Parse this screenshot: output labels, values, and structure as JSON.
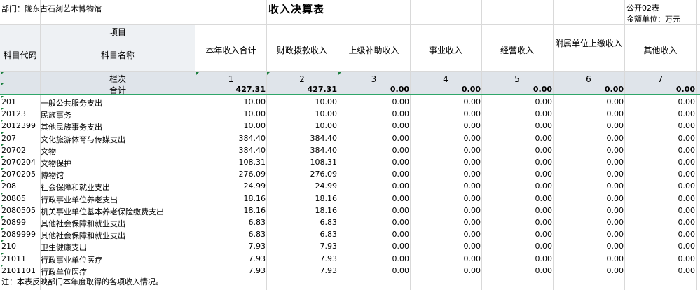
{
  "header": {
    "department": "部门：陇东古石刻艺术博物馆",
    "title": "收入决算表",
    "form_code": "公开02表",
    "unit": "金额单位：万元"
  },
  "columns": {
    "item_group": "项目",
    "code": "科目代码",
    "name": "科目名称",
    "c1": "本年收入合计",
    "c2": "财政拨款收入",
    "c3": "上级补助收入",
    "c4": "事业收入",
    "c5": "经营收入",
    "c6": "附属单位上缴收入",
    "c7": "其他收入"
  },
  "index_row": {
    "label": "栏次",
    "n1": "1",
    "n2": "2",
    "n3": "3",
    "n4": "4",
    "n5": "5",
    "n6": "6",
    "n7": "7"
  },
  "total_row": {
    "label": "合计",
    "v1": "427.31",
    "v2": "427.31",
    "v3": "0.00",
    "v4": "0.00",
    "v5": "0.00",
    "v6": "0.00",
    "v7": "0.00"
  },
  "rows": [
    {
      "code": "201",
      "name": "一般公共服务支出",
      "v1": "10.00",
      "v2": "10.00",
      "v3": "0.00",
      "v4": "0.00",
      "v5": "0.00",
      "v6": "0.00",
      "v7": "0.00"
    },
    {
      "code": "20123",
      "name": "民族事务",
      "v1": "10.00",
      "v2": "10.00",
      "v3": "0.00",
      "v4": "0.00",
      "v5": "0.00",
      "v6": "0.00",
      "v7": "0.00"
    },
    {
      "code": "2012399",
      "name": "其他民族事务支出",
      "v1": "10.00",
      "v2": "10.00",
      "v3": "0.00",
      "v4": "0.00",
      "v5": "0.00",
      "v6": "0.00",
      "v7": "0.00"
    },
    {
      "code": "207",
      "name": "文化旅游体育与传媒支出",
      "v1": "384.40",
      "v2": "384.40",
      "v3": "0.00",
      "v4": "0.00",
      "v5": "0.00",
      "v6": "0.00",
      "v7": "0.00"
    },
    {
      "code": "20702",
      "name": "文物",
      "v1": "384.40",
      "v2": "384.40",
      "v3": "0.00",
      "v4": "0.00",
      "v5": "0.00",
      "v6": "0.00",
      "v7": "0.00"
    },
    {
      "code": "2070204",
      "name": "文物保护",
      "v1": "108.31",
      "v2": "108.31",
      "v3": "0.00",
      "v4": "0.00",
      "v5": "0.00",
      "v6": "0.00",
      "v7": "0.00"
    },
    {
      "code": "2070205",
      "name": "博物馆",
      "v1": "276.09",
      "v2": "276.09",
      "v3": "0.00",
      "v4": "0.00",
      "v5": "0.00",
      "v6": "0.00",
      "v7": "0.00"
    },
    {
      "code": "208",
      "name": "社会保障和就业支出",
      "v1": "24.99",
      "v2": "24.99",
      "v3": "0.00",
      "v4": "0.00",
      "v5": "0.00",
      "v6": "0.00",
      "v7": "0.00"
    },
    {
      "code": "20805",
      "name": "行政事业单位养老支出",
      "v1": "18.16",
      "v2": "18.16",
      "v3": "0.00",
      "v4": "0.00",
      "v5": "0.00",
      "v6": "0.00",
      "v7": "0.00"
    },
    {
      "code": "2080505",
      "name": "机关事业单位基本养老保险缴费支出",
      "v1": "18.16",
      "v2": "18.16",
      "v3": "0.00",
      "v4": "0.00",
      "v5": "0.00",
      "v6": "0.00",
      "v7": "0.00"
    },
    {
      "code": "20899",
      "name": "其他社会保障和就业支出",
      "v1": "6.83",
      "v2": "6.83",
      "v3": "0.00",
      "v4": "0.00",
      "v5": "0.00",
      "v6": "0.00",
      "v7": "0.00"
    },
    {
      "code": "2089999",
      "name": "其他社会保障和就业支出",
      "v1": "6.83",
      "v2": "6.83",
      "v3": "0.00",
      "v4": "0.00",
      "v5": "0.00",
      "v6": "0.00",
      "v7": "0.00"
    },
    {
      "code": "210",
      "name": "卫生健康支出",
      "v1": "7.93",
      "v2": "7.93",
      "v3": "0.00",
      "v4": "0.00",
      "v5": "0.00",
      "v6": "0.00",
      "v7": "0.00"
    },
    {
      "code": "21011",
      "name": "行政事业单位医疗",
      "v1": "7.93",
      "v2": "7.93",
      "v3": "0.00",
      "v4": "0.00",
      "v5": "0.00",
      "v6": "0.00",
      "v7": "0.00"
    },
    {
      "code": "2101101",
      "name": "行政单位医疗",
      "v1": "7.93",
      "v2": "7.93",
      "v3": "0.00",
      "v4": "0.00",
      "v5": "0.00",
      "v6": "0.00",
      "v7": "0.00"
    }
  ],
  "footer": {
    "note": "注：本表反映部门本年度取得的各项收入情况。"
  }
}
